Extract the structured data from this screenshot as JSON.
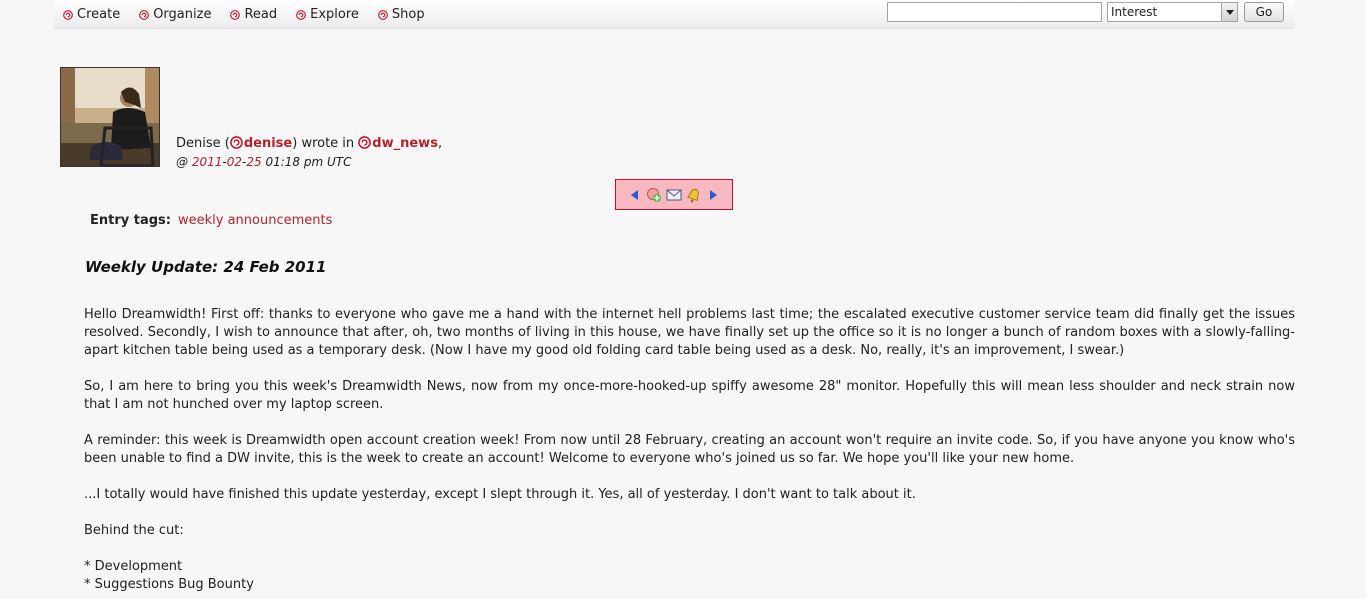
{
  "nav": {
    "items": [
      {
        "label": "Create"
      },
      {
        "label": "Organize"
      },
      {
        "label": "Read"
      },
      {
        "label": "Explore"
      },
      {
        "label": "Shop"
      }
    ]
  },
  "search": {
    "value": "",
    "select_value": "Interest",
    "go_label": "Go"
  },
  "entry": {
    "author_name": "Denise (",
    "author_user": "denise",
    "wrote_in": ") wrote in ",
    "community": "dw_news",
    "comma": ",",
    "date_prefix": "@ ",
    "date_year": "2011",
    "date_month": "02",
    "date_day": "25",
    "date_time": " 01:18 pm UTC",
    "tags_label": "Entry tags:",
    "tags_value": "weekly announcements",
    "title": "Weekly Update: 24 Feb 2011",
    "paragraphs": [
      "Hello Dreamwidth! First off: thanks to everyone who gave me a hand with the internet hell problems last time; the escalated executive customer service team did finally get the issues resolved. Secondly, I wish to announce that after, oh, two months of living in this house, we have finally set up the office so it is no longer a bunch of random boxes with a slowly-falling-apart kitchen table being used as a temporary desk. (Now I have my good old folding card table being used as a desk. No, really, it's an improvement, I swear.)",
      "So, I am here to bring you this week's Dreamwidth News, now from my once-more-hooked-up spiffy awesome 28\" monitor. Hopefully this will mean less shoulder and neck strain now that I am not hunched over my laptop screen.",
      "A reminder: this week is Dreamwidth open account creation week! From now until 28 February, creating an account won't require an invite code. So, if you have anyone you know who's been unable to find a DW invite, this is the week to create an account! Welcome to everyone who's joined us so far. We hope you'll like your new home.",
      "...I totally would have finished this update yesterday, except I slept through it. Yes, all of yesterday. I don't want to talk about it.",
      "Behind the cut:"
    ],
    "list": [
      "* Development",
      "* Suggestions Bug Bounty"
    ]
  },
  "colors": {
    "link": "#b3232e",
    "nav_highlight_bg": "#f7b8c0",
    "nav_highlight_border": "#c8102e"
  }
}
